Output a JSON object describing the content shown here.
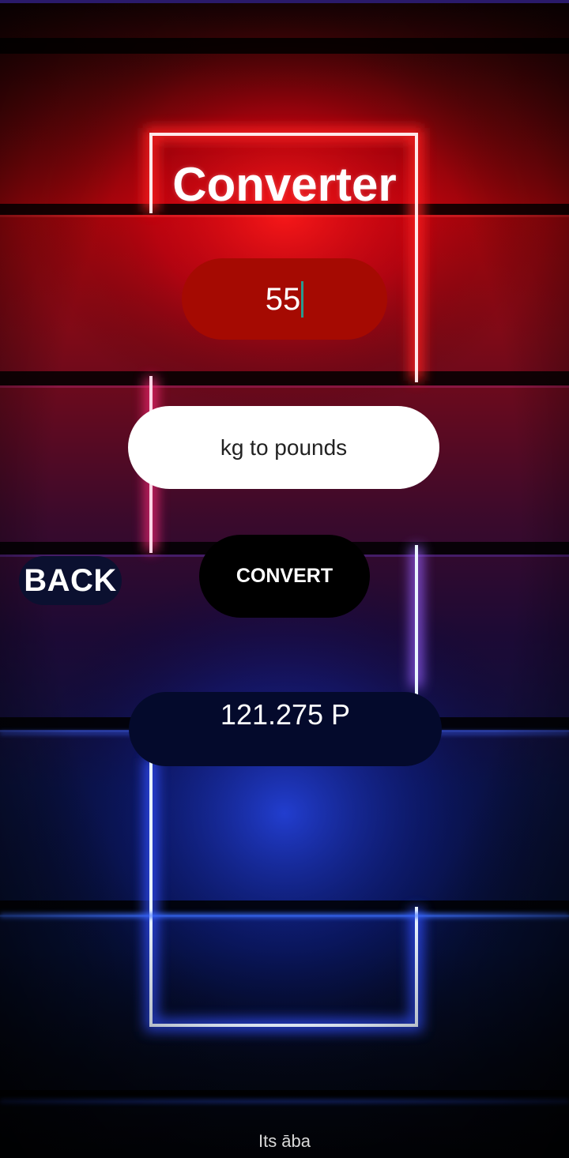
{
  "app": {
    "title": "Converter"
  },
  "amount_input": {
    "value": "55"
  },
  "unit_selector": {
    "label": "kg to pounds"
  },
  "buttons": {
    "back_label": "BACK",
    "convert_label": "CONVERT"
  },
  "result": {
    "text": "121.275 P"
  },
  "footer": {
    "text": "Its āba"
  },
  "colors": {
    "input_pill": "#a50a02",
    "unit_pill": "#ffffff",
    "convert_button": "#000000",
    "back_button": "#0b1030",
    "result_pill": "#040a2c",
    "neon_frame": "#f4f8ff",
    "glow_top": "#ff1010",
    "glow_bottom": "#1030ff"
  }
}
